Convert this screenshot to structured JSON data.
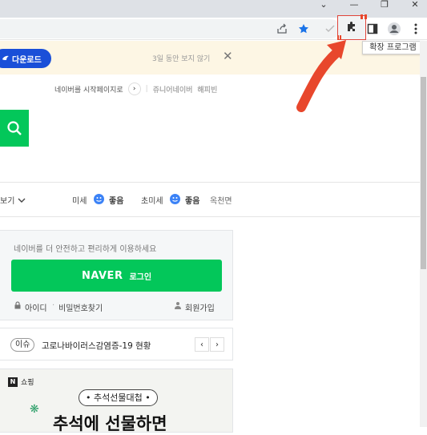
{
  "browser": {
    "window_controls": {
      "dropdown": "⌄",
      "minimize": "—",
      "restore": "❐",
      "close": "✕"
    },
    "toolbar_icons": [
      "share-icon",
      "star-icon",
      "check-icon",
      "puzzle-icon",
      "sidepanel-icon",
      "profile-icon",
      "menu-icon"
    ],
    "extensions_tooltip": "확장 프로그램",
    "accent_colors": {
      "star": "#1a73e8",
      "annotation_red": "#e8472c"
    }
  },
  "banner": {
    "download_label": "다운로드",
    "dismiss_text": "3일 동안 보지 않기",
    "close_glyph": "✕"
  },
  "top_links": {
    "homepage_text": "네이버를 시작페이지로",
    "arrow": "›",
    "junior_naver": "쥬니어네이버",
    "happybean": "해피빈"
  },
  "weather": {
    "left_fragment": "보기",
    "fine_dust_label": "미세",
    "fine_dust_status": "좋음",
    "ultrafine_dust_label": "초미세",
    "ultrafine_dust_status": "좋음",
    "location": "옥천면",
    "status_color": "#3b82f6"
  },
  "login": {
    "hint": "네이버를 더 안전하고 편리하게 이용하세요",
    "naver_brand": "NAVER",
    "login_label": "로그인",
    "id_label": "아이디",
    "separator": "·",
    "password_label": "비밀번호찾기",
    "signup_label": "회원가입",
    "brand_color": "#03c75a"
  },
  "news": {
    "tag": "이슈",
    "headline": "고로나바이러스감염증-19 현황",
    "prev": "‹",
    "next": "›"
  },
  "shopping": {
    "brand_letter": "N",
    "label": "쇼핑",
    "pill_text": "• 추석선물대첩 •",
    "headline": "추석에 선물하면"
  }
}
